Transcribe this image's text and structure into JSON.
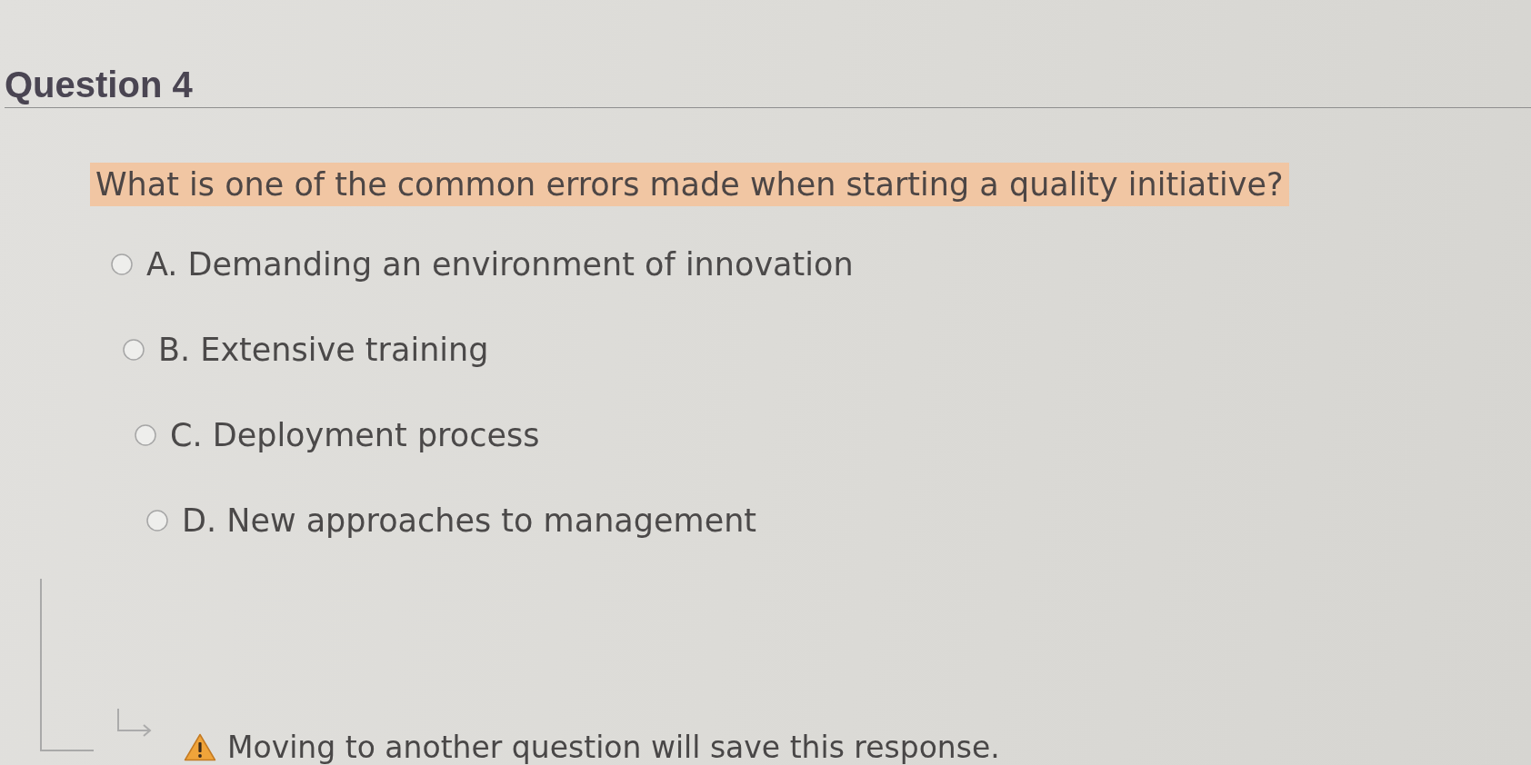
{
  "question": {
    "title": "Question 4",
    "prompt": "What is one of the common errors made when starting a quality initiative?",
    "highlighted": true
  },
  "options": [
    {
      "label": "A. Demanding an environment of innovation",
      "selected": false
    },
    {
      "label": "B. Extensive training",
      "selected": false
    },
    {
      "label": "C. Deployment process",
      "selected": false
    },
    {
      "label": "D. New approaches to management",
      "selected": false
    }
  ],
  "notice": {
    "text": "Moving to another question will save this response."
  }
}
